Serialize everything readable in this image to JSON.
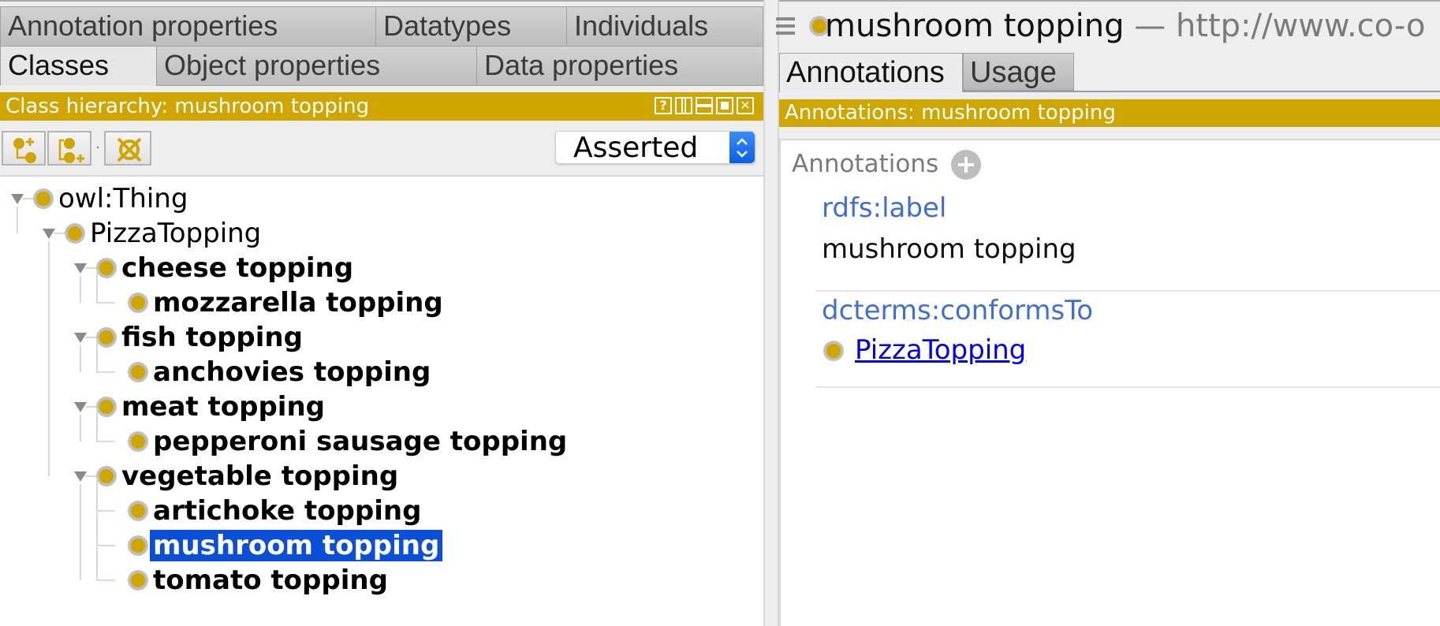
{
  "left_tabs": {
    "row1": [
      {
        "label": "Annotation properties"
      },
      {
        "label": "Datatypes"
      },
      {
        "label": "Individuals"
      }
    ],
    "row2": [
      {
        "label": "Classes",
        "active": true
      },
      {
        "label": "Object properties"
      },
      {
        "label": "Data properties"
      }
    ]
  },
  "class_hierarchy": {
    "title": "Class hierarchy: mushroom topping",
    "window_buttons": [
      "?",
      "split-vertical",
      "split-horizontal",
      "maximize",
      "close"
    ],
    "toolbar": {
      "add_subclass_icon": "add-subclass-icon",
      "add_sibling_icon": "add-sibling-class-icon",
      "delete_icon": "delete-class-icon"
    },
    "view_select": {
      "value": "Asserted"
    },
    "tree": [
      {
        "label": "owl:Thing",
        "level": 0,
        "expanded": true,
        "bold": false
      },
      {
        "label": "PizzaTopping",
        "level": 1,
        "expanded": true,
        "bold": false
      },
      {
        "label": "cheese topping",
        "level": 2,
        "expanded": true,
        "bold": true
      },
      {
        "label": "mozzarella topping",
        "level": 3,
        "bold": true
      },
      {
        "label": "fish topping",
        "level": 2,
        "expanded": true,
        "bold": true
      },
      {
        "label": "anchovies topping",
        "level": 3,
        "bold": true
      },
      {
        "label": "meat topping",
        "level": 2,
        "expanded": true,
        "bold": true
      },
      {
        "label": "pepperoni sausage topping",
        "level": 3,
        "bold": true
      },
      {
        "label": "vegetable topping",
        "level": 2,
        "expanded": true,
        "bold": true
      },
      {
        "label": "artichoke topping",
        "level": 3,
        "bold": true
      },
      {
        "label": "mushroom topping",
        "level": 3,
        "bold": true,
        "selected": true
      },
      {
        "label": "tomato topping",
        "level": 3,
        "bold": true
      }
    ]
  },
  "entity_header": {
    "menu_icon": "hamburger-icon",
    "name": "mushroom topping",
    "separator": "—",
    "uri": "http://www.co-o"
  },
  "right_tabs": [
    {
      "label": "Annotations",
      "active": true
    },
    {
      "label": "Usage"
    }
  ],
  "annotations_view": {
    "title": "Annotations: mushroom topping",
    "heading": "Annotations",
    "items": [
      {
        "property": "rdfs:label",
        "value": "mushroom topping"
      },
      {
        "property": "dcterms:conformsTo",
        "link": "PizzaTopping"
      }
    ]
  },
  "colors": {
    "accent_gold": "#cfa600",
    "selection_blue": "#0b4fd8",
    "property_blue": "#3f6fd6",
    "link_blue": "#0000ee"
  }
}
